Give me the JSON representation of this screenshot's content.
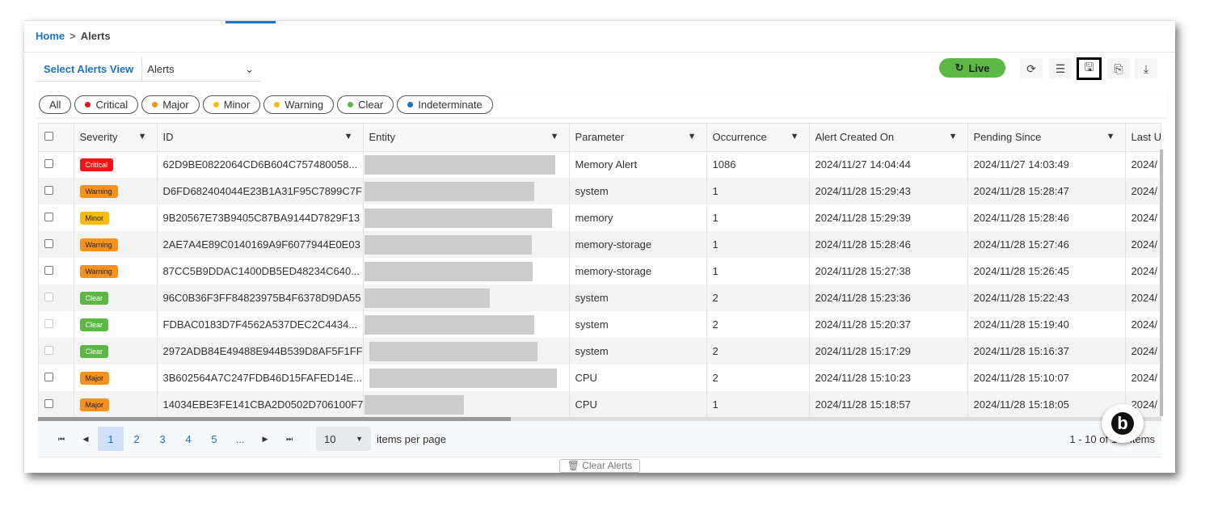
{
  "breadcrumb": {
    "home": "Home",
    "separator": ">",
    "current": "Alerts"
  },
  "view": {
    "label": "Select Alerts View",
    "selected": "Alerts"
  },
  "toolbar": {
    "live_label": "Live",
    "refresh_icon": "refresh-icon",
    "columns_icon": "columns-icon",
    "save_icon": "save-icon",
    "save_as_icon": "save-as-icon",
    "download_icon": "download-icon"
  },
  "filters": [
    {
      "label": "All",
      "color": ""
    },
    {
      "label": "Critical",
      "color": "#f01414"
    },
    {
      "label": "Major",
      "color": "#f5921e"
    },
    {
      "label": "Minor",
      "color": "#f7bb10"
    },
    {
      "label": "Warning",
      "color": "#f7bb10"
    },
    {
      "label": "Clear",
      "color": "#5cb844"
    },
    {
      "label": "Indeterminate",
      "color": "#1a73c8"
    }
  ],
  "columns": [
    "Severity",
    "ID",
    "Entity",
    "Parameter",
    "Occurrence",
    "Alert Created On",
    "Pending Since",
    "Last U"
  ],
  "severity_colors": {
    "Critical": "#f01414",
    "Warning": "#f5921e",
    "Minor": "#f7bb10",
    "Clear": "#5cb844",
    "Major": "#f5921e"
  },
  "rows": [
    {
      "severity": "Critical",
      "id": "62D9BE0822064CD6B604C757480058...",
      "parameter": "Memory Alert",
      "occurrence": "1086",
      "created": "2024/11/27 14:04:44",
      "pending": "2024/11/27 14:03:49",
      "last": "2024/"
    },
    {
      "severity": "Warning",
      "id": "D6FD682404044E23B1A31F95C7899C7F",
      "parameter": "system",
      "occurrence": "1",
      "created": "2024/11/28 15:29:43",
      "pending": "2024/11/28 15:28:47",
      "last": "2024/"
    },
    {
      "severity": "Minor",
      "id": "9B20567E73B9405C87BA9144D7829F13",
      "parameter": "memory",
      "occurrence": "1",
      "created": "2024/11/28 15:29:39",
      "pending": "2024/11/28 15:28:46",
      "last": "2024/"
    },
    {
      "severity": "Warning",
      "id": "2AE7A4E89C0140169A9F6077944E0E03",
      "parameter": "memory-storage",
      "occurrence": "1",
      "created": "2024/11/28 15:28:46",
      "pending": "2024/11/28 15:27:46",
      "last": "2024/"
    },
    {
      "severity": "Warning",
      "id": "87CC5B9DDAC1400DB5ED48234C640...",
      "parameter": "memory-storage",
      "occurrence": "1",
      "created": "2024/11/28 15:27:38",
      "pending": "2024/11/28 15:26:45",
      "last": "2024/"
    },
    {
      "severity": "Clear",
      "id": "96C0B36F3FF84823975B4F6378D9DA55",
      "parameter": "system",
      "occurrence": "2",
      "created": "2024/11/28 15:23:36",
      "pending": "2024/11/28 15:22:43",
      "last": "2024/"
    },
    {
      "severity": "Clear",
      "id": "FDBAC0183D7F4562A537DEC2C4434...",
      "parameter": "system",
      "occurrence": "2",
      "created": "2024/11/28 15:20:37",
      "pending": "2024/11/28 15:19:40",
      "last": "2024/"
    },
    {
      "severity": "Clear",
      "id": "2972ADB84E49488E944B539D8AF5F1FF",
      "parameter": "system",
      "occurrence": "2",
      "created": "2024/11/28 15:17:29",
      "pending": "2024/11/28 15:16:37",
      "last": "2024/"
    },
    {
      "severity": "Major",
      "id": "3B602564A7C247FDB46D15FAFED14E...",
      "parameter": "CPU",
      "occurrence": "2",
      "created": "2024/11/28 15:10:23",
      "pending": "2024/11/28 15:10:07",
      "last": "2024/"
    },
    {
      "severity": "Major",
      "id": "14034EBE3FE141CBA2D0502D706100F7",
      "parameter": "CPU",
      "occurrence": "1",
      "created": "2024/11/28 15:18:57",
      "pending": "2024/11/28 15:18:05",
      "last": "2024/"
    }
  ],
  "pagination": {
    "first": "⏮",
    "prev": "◀",
    "pages": [
      "1",
      "2",
      "3",
      "4",
      "5",
      "..."
    ],
    "next": "▶",
    "last": "⏭",
    "page_size": "10",
    "items_per_page": "items per page",
    "count": "1 - 10 of 1",
    "count_suffix": "items"
  },
  "footer": {
    "clear_alerts": "Clear Alerts"
  }
}
